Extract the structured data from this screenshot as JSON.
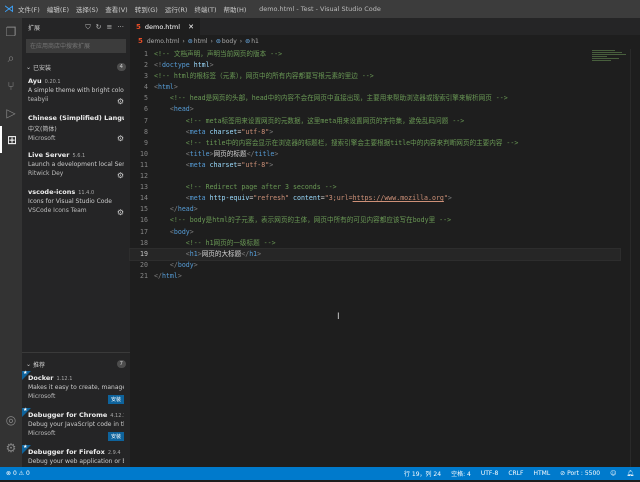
{
  "titlebar": {
    "title": "demo.html - Test - Visual Studio Code",
    "menu": [
      "文件(F)",
      "编辑(E)",
      "选择(S)",
      "查看(V)",
      "转到(G)",
      "运行(R)",
      "终端(T)",
      "帮助(H)"
    ]
  },
  "activity_bar": [
    "files-icon",
    "search-icon",
    "source-control-icon",
    "run-debug-icon",
    "extensions-icon",
    "account-icon",
    "gear-icon"
  ],
  "sidebar": {
    "title": "扩展",
    "search_placeholder": "在应用商店中搜索扩展",
    "installed": {
      "label": "已安装",
      "count": "4",
      "items": [
        {
          "name": "Ayu",
          "version": "0.20.1",
          "desc": "A simple theme with bright colors and...",
          "publisher": "teabyii"
        },
        {
          "name": "Chinese (Simplified) Langu...",
          "version": "1.56.2",
          "desc": "中文(简体)",
          "publisher": "Microsoft"
        },
        {
          "name": "Live Server",
          "version": "5.6.1",
          "desc": "Launch a development local Server wi...",
          "publisher": "Ritwick Dey"
        },
        {
          "name": "vscode-icons",
          "version": "11.4.0",
          "desc": "Icons for Visual Studio Code",
          "publisher": "VSCode Icons Team"
        }
      ]
    },
    "recommended": {
      "label": "推荐",
      "count": "7",
      "install_label": "安装",
      "items": [
        {
          "name": "Docker",
          "version": "1.12.1",
          "desc": "Makes it easy to create, manage, and ...",
          "publisher": "Microsoft"
        },
        {
          "name": "Debugger for Chrome",
          "version": "4.12.12",
          "desc": "Debug your JavaScript code in the Ch...",
          "publisher": "Microsoft"
        },
        {
          "name": "Debugger for Firefox",
          "version": "2.9.4",
          "desc": "Debug your web application or brows...",
          "publisher": "Firefox DevTools"
        }
      ]
    }
  },
  "editor": {
    "tab": "demo.html",
    "breadcrumb": [
      "demo.html",
      "html",
      "body",
      "h1"
    ],
    "current_line": 19,
    "lines": [
      [
        [
          "c",
          "<!-- 文档声明，声明当前网页的版本 -->"
        ]
      ],
      [
        [
          "br",
          "<!"
        ],
        [
          "tg",
          "doctype"
        ],
        [
          "at",
          " html"
        ],
        [
          "br",
          ">"
        ]
      ],
      [
        [
          "c",
          "<!-- html的根标签（元素），网页中的所有内容都要写根元素的里边 -->"
        ]
      ],
      [
        [
          "br",
          "<"
        ],
        [
          "tg",
          "html"
        ],
        [
          "br",
          ">"
        ]
      ],
      [
        [
          "tx",
          "    "
        ],
        [
          "c",
          "<!-- head是网页的头部，head中的内容不会在网页中直接出现，主要用来帮助浏览器或搜索引擎来解析网页 -->"
        ]
      ],
      [
        [
          "tx",
          "    "
        ],
        [
          "br",
          "<"
        ],
        [
          "tg",
          "head"
        ],
        [
          "br",
          ">"
        ]
      ],
      [
        [
          "tx",
          "        "
        ],
        [
          "c",
          "<!-- meta标签用来设置网页的元数据，这里meta用来设置网页的字符集，避免乱码问题 -->"
        ]
      ],
      [
        [
          "tx",
          "        "
        ],
        [
          "br",
          "<"
        ],
        [
          "tg",
          "meta"
        ],
        [
          "at",
          " charset"
        ],
        [
          "tx",
          "="
        ],
        [
          "st",
          "\"utf-8\""
        ],
        [
          "br",
          ">"
        ]
      ],
      [
        [
          "tx",
          "        "
        ],
        [
          "c",
          "<!-- title中的内容会显示在浏览器的标题栏，搜索引擎会主要根据title中的内容来判断网页的主要内容 -->"
        ]
      ],
      [
        [
          "tx",
          "        "
        ],
        [
          "br",
          "<"
        ],
        [
          "tg",
          "title"
        ],
        [
          "br",
          ">"
        ],
        [
          "tx",
          "网页的标题"
        ],
        [
          "br",
          "</"
        ],
        [
          "tg",
          "title"
        ],
        [
          "br",
          ">"
        ]
      ],
      [
        [
          "tx",
          "        "
        ],
        [
          "br",
          "<"
        ],
        [
          "tg",
          "meta"
        ],
        [
          "at",
          " charset"
        ],
        [
          "tx",
          "="
        ],
        [
          "st",
          "\"utf-8\""
        ],
        [
          "br",
          ">"
        ]
      ],
      [],
      [
        [
          "tx",
          "        "
        ],
        [
          "c",
          "<!-- Redirect page after 3 seconds -->"
        ]
      ],
      [
        [
          "tx",
          "        "
        ],
        [
          "br",
          "<"
        ],
        [
          "tg",
          "meta"
        ],
        [
          "at",
          " http-equiv"
        ],
        [
          "tx",
          "="
        ],
        [
          "st",
          "\"refresh\""
        ],
        [
          "at",
          " content"
        ],
        [
          "tx",
          "="
        ],
        [
          "st",
          "\"3;url="
        ],
        [
          "stu",
          "https://www.mozilla.org"
        ],
        [
          "st",
          "\""
        ],
        [
          "br",
          ">"
        ]
      ],
      [
        [
          "tx",
          "    "
        ],
        [
          "br",
          "</"
        ],
        [
          "tg",
          "head"
        ],
        [
          "br",
          ">"
        ]
      ],
      [
        [
          "tx",
          "    "
        ],
        [
          "c",
          "<!-- body是html的子元素，表示网页的主体，网页中所有的可见内容都应该写在body里 -->"
        ]
      ],
      [
        [
          "tx",
          "    "
        ],
        [
          "br",
          "<"
        ],
        [
          "tg",
          "body"
        ],
        [
          "br",
          ">"
        ]
      ],
      [
        [
          "tx",
          "        "
        ],
        [
          "c",
          "<!-- h1网页的一级标题 -->"
        ]
      ],
      [
        [
          "tx",
          "        "
        ],
        [
          "br",
          "<"
        ],
        [
          "tg",
          "h1"
        ],
        [
          "br",
          ">"
        ],
        [
          "tx",
          "网页的大标题"
        ],
        [
          "br",
          "</"
        ],
        [
          "tg",
          "h1"
        ],
        [
          "br",
          ">"
        ]
      ],
      [
        [
          "tx",
          "    "
        ],
        [
          "br",
          "</"
        ],
        [
          "tg",
          "body"
        ],
        [
          "br",
          ">"
        ]
      ],
      [
        [
          "br",
          "</"
        ],
        [
          "tg",
          "html"
        ],
        [
          "br",
          ">"
        ]
      ]
    ]
  },
  "statusbar": {
    "errors": "0",
    "warnings": "0",
    "position": "行 19，列 24",
    "spaces": "空格: 4",
    "encoding": "UTF-8",
    "eol": "CRLF",
    "language": "HTML",
    "port": "Port : 5500"
  },
  "colors": {
    "accent": "#007acc",
    "comment": "#6a9955",
    "tag": "#569cd6",
    "attr": "#9cdcfe",
    "string": "#ce9178"
  }
}
